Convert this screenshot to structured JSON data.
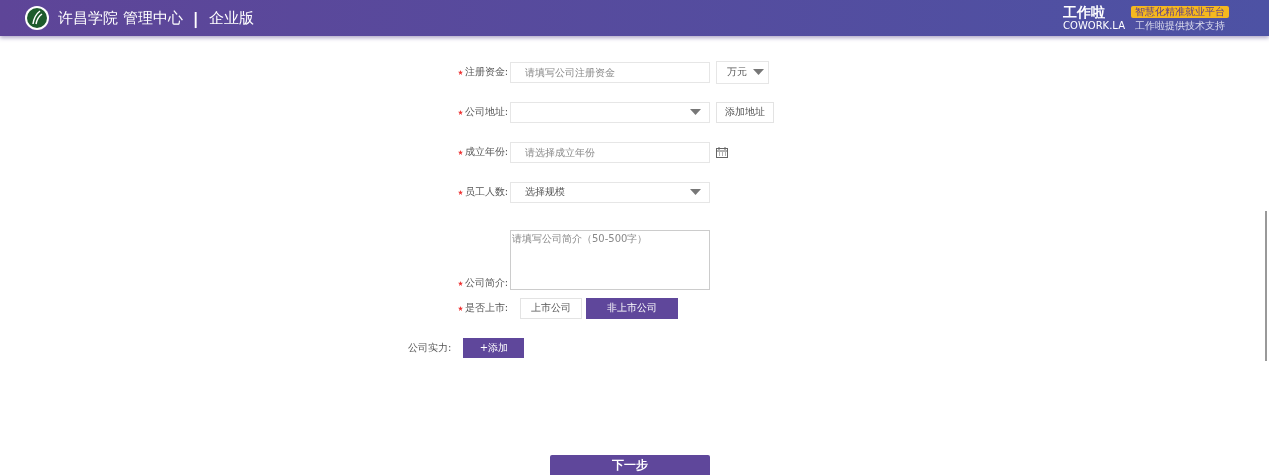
{
  "header": {
    "title": "许昌学院 管理中心",
    "separator": "|",
    "edition": "企业版",
    "brand": {
      "name": "工作啦",
      "domain": "COWORK.LA",
      "slogan": "智慧化精准就业平台",
      "support": "工作啦提供技术支持"
    }
  },
  "form": [
    {
      "kind": "input_unit",
      "label": "注册资金:",
      "required": true,
      "placeholder": "请填写公司注册资金",
      "unit": "万元"
    },
    {
      "kind": "select_button",
      "label": "公司地址:",
      "required": true,
      "button": "添加地址"
    },
    {
      "kind": "date",
      "label": "成立年份:",
      "required": true,
      "placeholder": "请选择成立年份"
    },
    {
      "kind": "select",
      "label": "员工人数:",
      "required": true,
      "value": "选择规模"
    },
    {
      "kind": "textarea",
      "label": "公司简介:",
      "required": true,
      "placeholder": "请填写公司简介（50-500字）"
    },
    {
      "kind": "choice",
      "label": "是否上市:",
      "required": true,
      "options": [
        {
          "label": "上市公司",
          "selected": false
        },
        {
          "label": "非上市公司",
          "selected": true
        }
      ]
    },
    {
      "kind": "add",
      "label": "公司实力:",
      "required": false,
      "button": "+添加"
    }
  ],
  "next_button": "下一步"
}
